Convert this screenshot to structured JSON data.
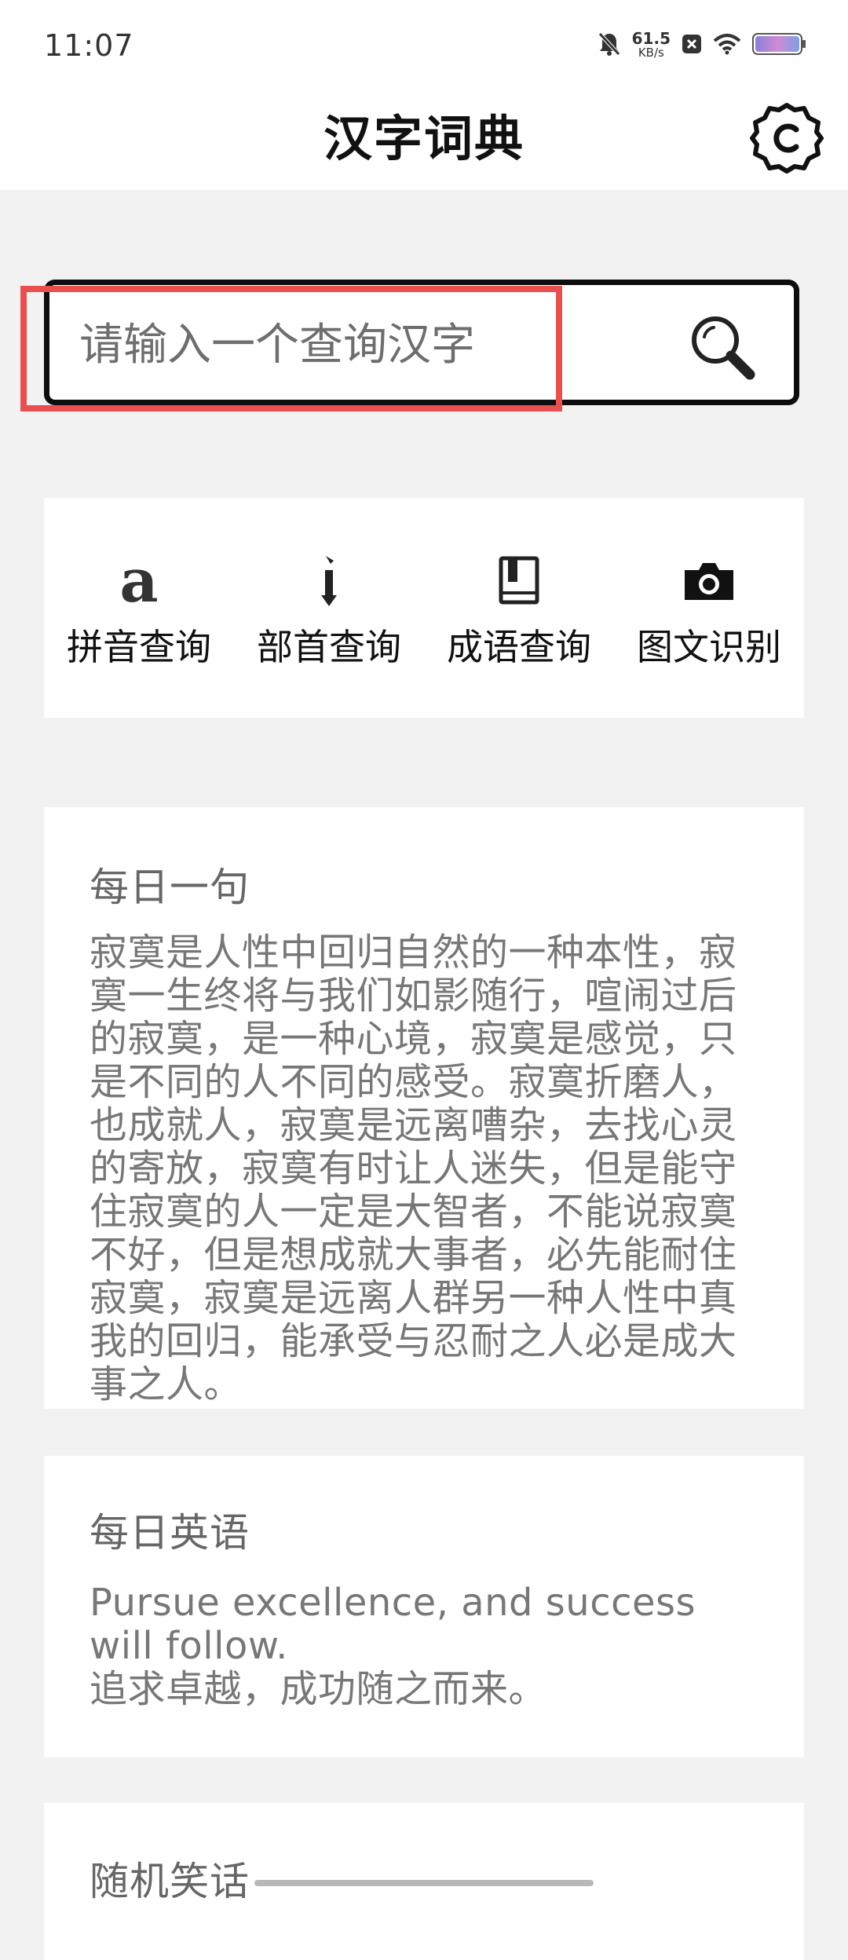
{
  "status_bar": {
    "time": "11:07",
    "net_speed_value": "61.5",
    "net_speed_unit": "KB/s",
    "icons": [
      "mute-bell-icon",
      "notification-x-icon",
      "wifi-icon",
      "battery-icon"
    ]
  },
  "header": {
    "title": "汉字词典",
    "settings_icon": "gear-icon"
  },
  "search": {
    "placeholder": "请输入一个查询汉字",
    "value": "",
    "button_icon": "search-icon"
  },
  "tools": [
    {
      "label": "拼音查询",
      "icon": "letter-a-icon"
    },
    {
      "label": "部首查询",
      "icon": "radical-stroke-icon"
    },
    {
      "label": "成语查询",
      "icon": "book-icon"
    },
    {
      "label": "图文识别",
      "icon": "camera-icon"
    }
  ],
  "daily_quote": {
    "title": "每日一句",
    "text": "寂寞是人性中回归自然的一种本性，寂寞一生终将与我们如影随行，喧闹过后的寂寞，是一种心境，寂寞是感觉，只是不同的人不同的感受。寂寞折磨人，也成就人，寂寞是远离嘈杂，去找心灵的寄放，寂寞有时让人迷失，但是能守住寂寞的人一定是大智者，不能说寂寞不好，但是想成就大事者，必先能耐住寂寞，寂寞是远离人群另一种人性中真我的回归，能承受与忍耐之人必是成大事之人。"
  },
  "daily_english": {
    "title": "每日英语",
    "english": "Pursue excellence, and success will follow.",
    "chinese": "追求卓越，成功随之而来。"
  },
  "random_joke": {
    "title": "随机笑话"
  },
  "colors": {
    "background": "#f2f2f2",
    "card": "#ffffff",
    "highlight": "#e8504f",
    "text_muted": "#777777"
  }
}
